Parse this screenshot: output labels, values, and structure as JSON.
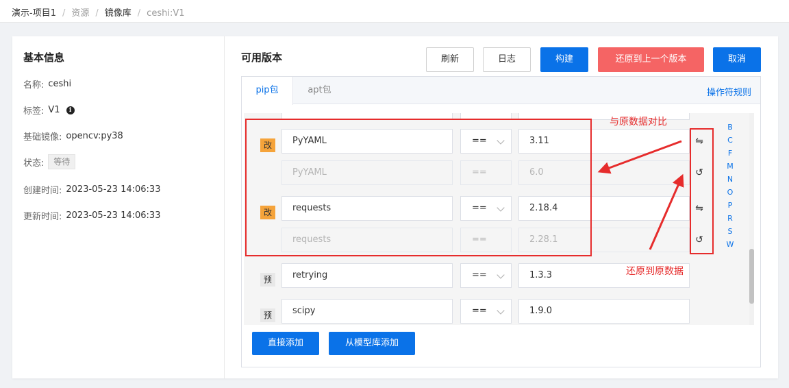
{
  "breadcrumb": [
    "演示-项目1",
    "资源",
    "镜像库",
    "ceshi:V1"
  ],
  "basic_info": {
    "title": "基本信息",
    "name_label": "名称:",
    "name": "ceshi",
    "tag_label": "标签:",
    "tag": "V1",
    "base_image_label": "基础镜像:",
    "base_image": "opencv:py38",
    "status_label": "状态:",
    "status": "等待",
    "created_label": "创建时间:",
    "created": "2023-05-23 14:06:33",
    "updated_label": "更新时间:",
    "updated": "2023-05-23 14:06:33"
  },
  "versions": {
    "title": "可用版本",
    "buttons": {
      "refresh": "刷新",
      "log": "日志",
      "build": "构建",
      "revert": "还原到上一个版本",
      "cancel": "取消"
    },
    "tabs": [
      "pip包",
      "apt包"
    ],
    "rules_link": "操作符规则",
    "packages": [
      {
        "badge": "改",
        "name": "PyYAML",
        "op": "==",
        "version": "3.11",
        "original": {
          "name": "PyYAML",
          "op": "==",
          "version": "6.0"
        }
      },
      {
        "badge": "改",
        "name": "requests",
        "op": "==",
        "version": "2.18.4",
        "original": {
          "name": "requests",
          "op": "==",
          "version": "2.28.1"
        }
      },
      {
        "badge": "预",
        "name": "retrying",
        "op": "==",
        "version": "1.3.3"
      },
      {
        "badge": "预",
        "name": "scipy",
        "op": "==",
        "version": "1.9.0"
      }
    ],
    "letter_index": [
      "B",
      "C",
      "F",
      "M",
      "N",
      "O",
      "P",
      "R",
      "S",
      "W"
    ],
    "add_direct": "直接添加",
    "add_from_library": "从模型库添加"
  },
  "annotations": {
    "compare_label": "与原数据对比",
    "restore_label": "还原到原数据",
    "color": "#e62c2c"
  },
  "colors": {
    "primary": "#0a72e8",
    "danger": "#f56464",
    "modified_badge": "#f5a33a"
  },
  "icons": {
    "compare": "swap-arrows-icon",
    "restore": "undo-icon",
    "info": "info-icon"
  }
}
